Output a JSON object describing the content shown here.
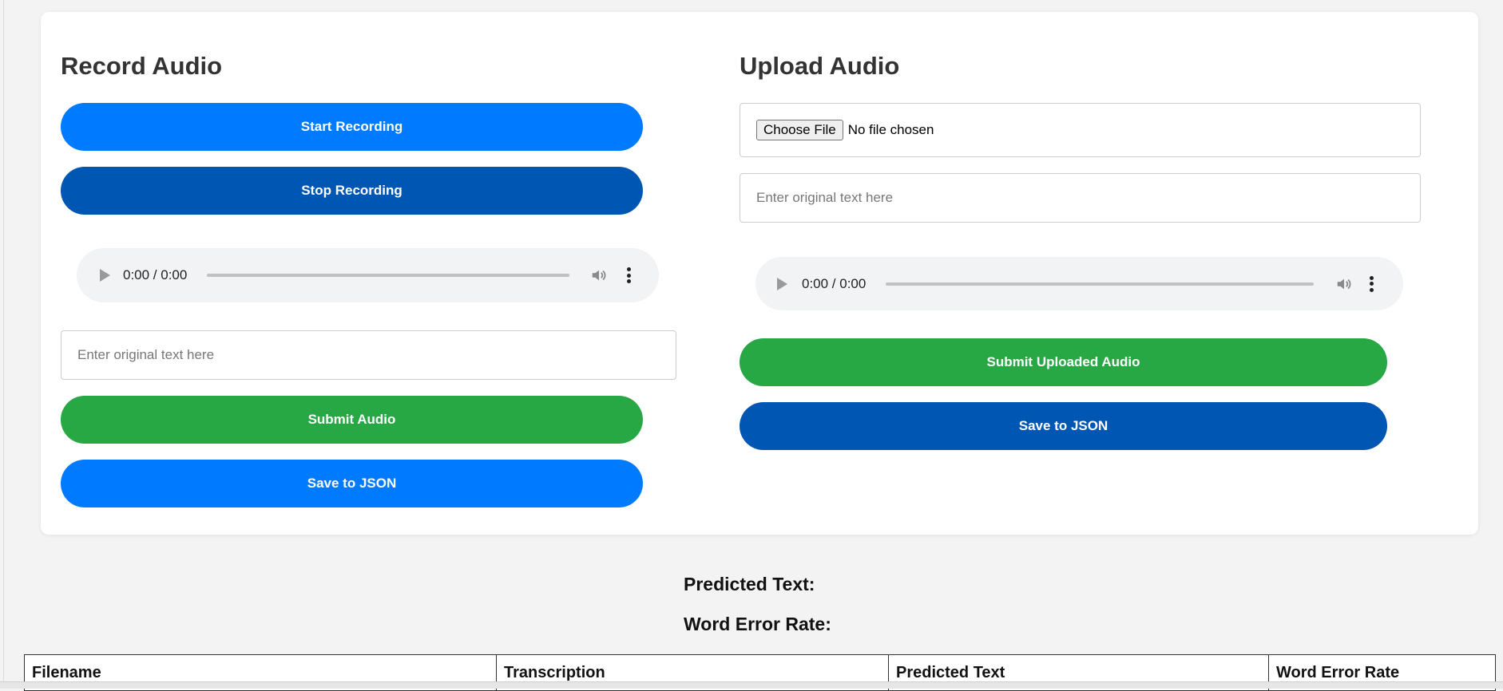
{
  "record": {
    "heading": "Record Audio",
    "start_label": "Start Recording",
    "stop_label": "Stop Recording",
    "player_time": "0:00 / 0:00",
    "text_placeholder": "Enter original text here",
    "submit_label": "Submit Audio",
    "save_label": "Save to JSON"
  },
  "upload": {
    "heading": "Upload Audio",
    "choose_file_label": "Choose File",
    "no_file_text": "No file chosen",
    "text_placeholder": "Enter original text here",
    "player_time": "0:00 / 0:00",
    "submit_label": "Submit Uploaded Audio",
    "save_label": "Save to JSON"
  },
  "results": {
    "predicted_label": "Predicted Text:",
    "wer_label": "Word Error Rate:"
  },
  "table": {
    "headers": [
      "Filename",
      "Transcription",
      "Predicted Text",
      "Word Error Rate"
    ]
  },
  "colors": {
    "primary_blue": "#007bff",
    "dark_blue": "#0056b3",
    "green": "#28a745",
    "card_bg": "#ffffff",
    "page_bg": "#f3f3f3"
  },
  "icons": {
    "play": "play-icon",
    "volume": "volume-icon",
    "more": "more-options-icon"
  }
}
